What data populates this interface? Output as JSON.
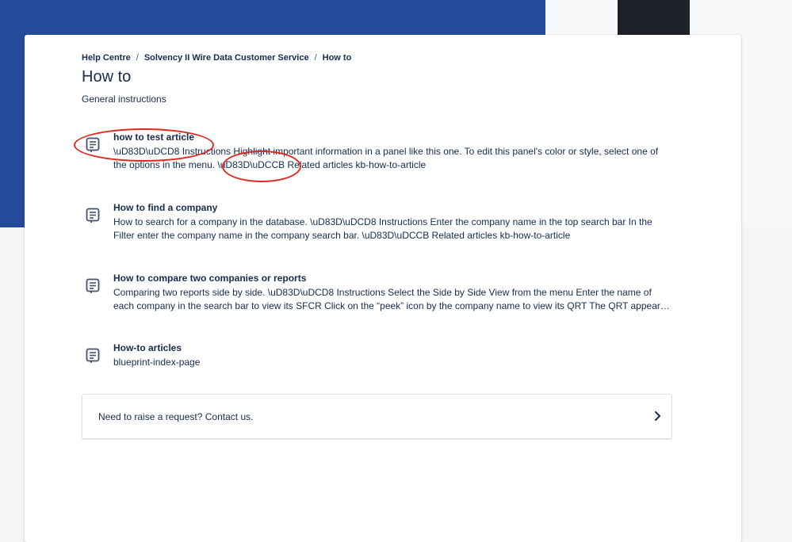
{
  "page": {
    "breadcrumb": {
      "items": [
        "Help Centre",
        "Solvency II Wire Data Customer Service",
        "How to"
      ],
      "separator": "/"
    },
    "title": "How to",
    "description": "General instructions"
  },
  "articles": [
    {
      "title": "how to test article",
      "excerpt": "\\uD83D\\uDCD8  Instructions Highlight important information in a panel like this one. To edit this panel's color or style, select one of the options in the menu. \\uD83D\\uDCCB  Related articles kb-how-to-article",
      "icon": "page-icon"
    },
    {
      "title": "How to find a company",
      "excerpt": "How to search for a company in the database. \\uD83D\\uDCD8  Instructions Enter the company name in the top search bar In the Filter enter the company name in the company search bar. \\uD83D\\uDCCB  Related articles kb-how-to-article",
      "icon": "page-icon"
    },
    {
      "title": "How to compare two companies or reports",
      "excerpt": "Comparing two reports side by side. \\uD83D\\uDCD8  Instructions Select the Side by Side View from the menu Enter the name of each company in the search bar to view its SFCR Click on the “peek” icon by the company name to view its QRT The QRT appears in the panel",
      "icon": "page-icon"
    },
    {
      "title": "How-to articles",
      "excerpt": "blueprint-index-page",
      "icon": "page-icon"
    }
  ],
  "request": {
    "label": "Need to raise a request? Contact us.",
    "icon": "chevron-right-icon"
  },
  "colors": {
    "banner": "#234b9a",
    "text": "#172b4d",
    "annotation": "#e0281e"
  }
}
